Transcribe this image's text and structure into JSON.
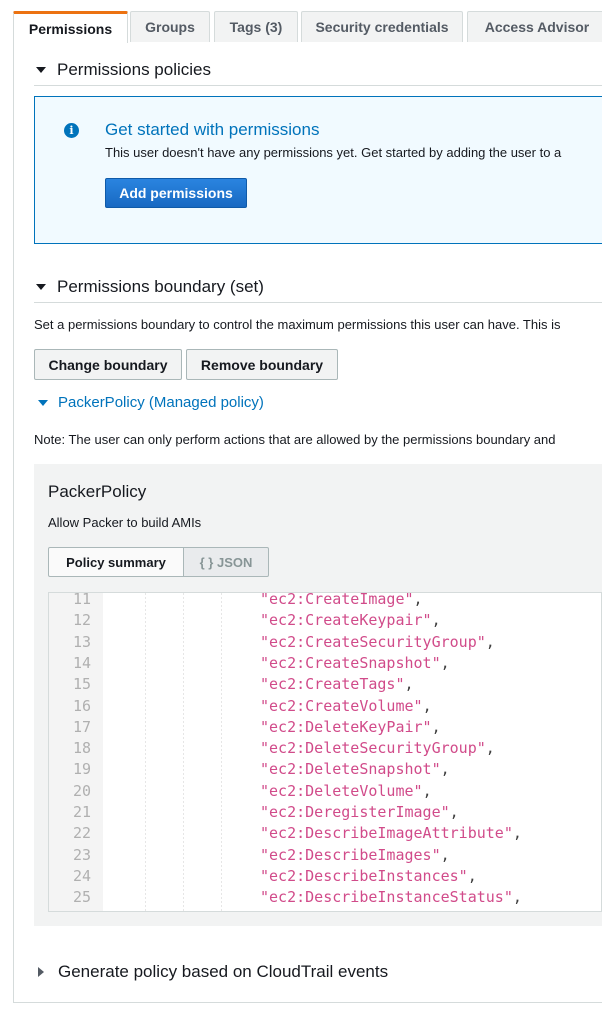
{
  "tabs": [
    {
      "label": "Permissions",
      "active": true
    },
    {
      "label": "Groups",
      "active": false
    },
    {
      "label": "Tags (3)",
      "active": false
    },
    {
      "label": "Security credentials",
      "active": false
    },
    {
      "label": "Access Advisor",
      "active": false
    }
  ],
  "permissions_policies": {
    "header": "Permissions policies",
    "info": {
      "icon": "info-icon",
      "title": "Get started with permissions",
      "text": "This user doesn't have any permissions yet. Get started by adding the user to a",
      "button": "Add permissions"
    }
  },
  "permissions_boundary": {
    "header": "Permissions boundary (set)",
    "description": "Set a permissions boundary to control the maximum permissions this user can have. This is",
    "change_button": "Change boundary",
    "remove_button": "Remove boundary",
    "policy_link": "PackerPolicy (Managed policy)",
    "note": "Note: The user can only perform actions that are allowed by the permissions boundary and"
  },
  "policy": {
    "name": "PackerPolicy",
    "description": "Allow Packer to build AMIs",
    "view_tabs": {
      "summary": "Policy summary",
      "json": "{ } JSON",
      "selected": "summary"
    },
    "code_lines": [
      {
        "n": "11",
        "text": "\"ec2:CreateImage\"",
        "sep": ","
      },
      {
        "n": "12",
        "text": "\"ec2:CreateKeypair\"",
        "sep": ","
      },
      {
        "n": "13",
        "text": "\"ec2:CreateSecurityGroup\"",
        "sep": ","
      },
      {
        "n": "14",
        "text": "\"ec2:CreateSnapshot\"",
        "sep": ","
      },
      {
        "n": "15",
        "text": "\"ec2:CreateTags\"",
        "sep": ","
      },
      {
        "n": "16",
        "text": "\"ec2:CreateVolume\"",
        "sep": ","
      },
      {
        "n": "17",
        "text": "\"ec2:DeleteKeyPair\"",
        "sep": ","
      },
      {
        "n": "18",
        "text": "\"ec2:DeleteSecurityGroup\"",
        "sep": ","
      },
      {
        "n": "19",
        "text": "\"ec2:DeleteSnapshot\"",
        "sep": ","
      },
      {
        "n": "20",
        "text": "\"ec2:DeleteVolume\"",
        "sep": ","
      },
      {
        "n": "21",
        "text": "\"ec2:DeregisterImage\"",
        "sep": ","
      },
      {
        "n": "22",
        "text": "\"ec2:DescribeImageAttribute\"",
        "sep": ","
      },
      {
        "n": "23",
        "text": "\"ec2:DescribeImages\"",
        "sep": ","
      },
      {
        "n": "24",
        "text": "\"ec2:DescribeInstances\"",
        "sep": ","
      },
      {
        "n": "25",
        "text": "\"ec2:DescribeInstanceStatus\"",
        "sep": ","
      }
    ]
  },
  "cloudtrail": {
    "header": "Generate policy based on CloudTrail events"
  },
  "colors": {
    "accent_orange": "#ec7211",
    "link_blue": "#0073bb",
    "primary_button": "#1a73d1",
    "code_string": "#d14b8a"
  }
}
